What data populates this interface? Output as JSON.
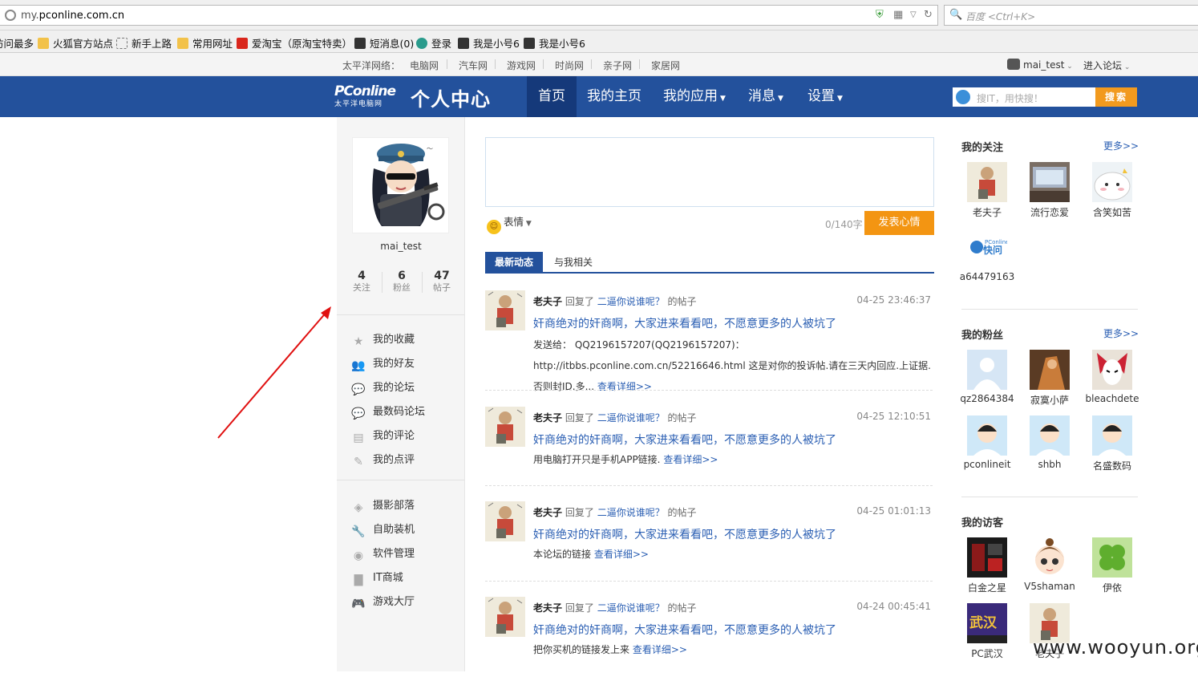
{
  "browser": {
    "url_gray": "my.",
    "url_host": "pconline.com.cn",
    "search_placeholder": "百度 <Ctrl+K>"
  },
  "bookmarks": [
    "访问最多",
    "火狐官方站点",
    "新手上路",
    "常用网址",
    "爱淘宝（原淘宝特卖）",
    "短消息(0)",
    "登录",
    "我是小号6",
    "我是小号6"
  ],
  "topnav": {
    "label": "太平洋网络：",
    "links": [
      "电脑网",
      "汽车网",
      "游戏网",
      "时尚网",
      "亲子网",
      "家居网"
    ],
    "user": "mai_test",
    "forum": "进入论坛"
  },
  "header": {
    "logo_text": "PConline",
    "logo_sub": "太平洋电脑网",
    "site_title": "个人中心",
    "nav": [
      "首页",
      "我的主页",
      "我的应用",
      "消息",
      "设置"
    ],
    "search_placeholder": "搜IT，用快搜！",
    "search_button": "搜索"
  },
  "profile": {
    "username": "mai_test",
    "stats": [
      {
        "n": "4",
        "l": "关注"
      },
      {
        "n": "6",
        "l": "粉丝"
      },
      {
        "n": "47",
        "l": "帖子"
      }
    ]
  },
  "menu1": [
    "我的收藏",
    "我的好友",
    "我的论坛",
    "最数码论坛",
    "我的评论",
    "我的点评"
  ],
  "menu2": [
    "摄影部落",
    "自助装机",
    "软件管理",
    "IT商城",
    "游戏大厅"
  ],
  "composer": {
    "emoji": "表情",
    "counter": "0/140字",
    "post_button": "发表心情"
  },
  "tabs": [
    "最新动态",
    "与我相关"
  ],
  "feed": [
    {
      "who": "老夫子",
      "verb": "回复了",
      "thread": "二逼你说谁呢？",
      "suffix": "的帖子",
      "time": "04-25 23:46:37",
      "title": "奸商绝对的奸商啊，大家进来看看吧，不愿意更多的人被坑了",
      "body": "发送给： QQ2196157207(QQ2196157207)： http://itbbs.pconline.com.cn/52216646.html 这是对你的投诉帖.请在三天内回应.上证据.否则封ID.多...",
      "more": "查看详细>>"
    },
    {
      "who": "老夫子",
      "verb": "回复了",
      "thread": "二逼你说谁呢？",
      "suffix": "的帖子",
      "time": "04-25 12:10:51",
      "title": "奸商绝对的奸商啊，大家进来看看吧，不愿意更多的人被坑了",
      "body": "用电脑打开只是手机APP链接.",
      "more": "查看详细>>"
    },
    {
      "who": "老夫子",
      "verb": "回复了",
      "thread": "二逼你说谁呢？",
      "suffix": "的帖子",
      "time": "04-25 01:01:13",
      "title": "奸商绝对的奸商啊，大家进来看看吧，不愿意更多的人被坑了",
      "body": "本论坛的链接",
      "more": "查看详细>>"
    },
    {
      "who": "老夫子",
      "verb": "回复了",
      "thread": "二逼你说谁呢？",
      "suffix": "的帖子",
      "time": "04-24 00:45:41",
      "title": "奸商绝对的奸商啊，大家进来看看吧，不愿意更多的人被坑了",
      "body": "把你买机的链接发上来",
      "more": "查看详细>>"
    }
  ],
  "right": {
    "more": "更多>>",
    "following_title": "我的关注",
    "following": [
      "老夫子",
      "流行恋爱",
      "含笑如苦",
      "a64479163"
    ],
    "fans_title": "我的粉丝",
    "fans": [
      "qz2864384",
      "寂寞小萨",
      "bleachdete",
      "pconlineit",
      "shbh",
      "名盛数码"
    ],
    "visitors_title": "我的访客",
    "visitors": [
      "白金之星",
      "V5shaman",
      "伊依",
      "PC武汉",
      "老夫子"
    ]
  },
  "watermark": "www.wooyun.org",
  "colors": {
    "header_blue": "#23519c",
    "accent_orange": "#f39512",
    "link_blue": "#2b5fb3"
  }
}
